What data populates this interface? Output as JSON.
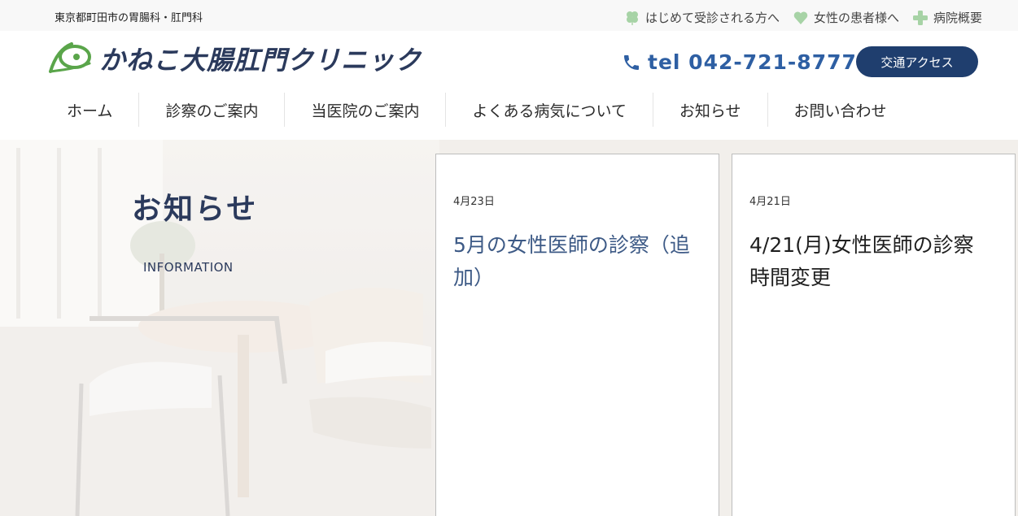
{
  "topbar": {
    "region": "東京都町田市の胃腸科・肛門科",
    "links": [
      {
        "label": "はじめて受診される方へ",
        "icon": "clover-icon",
        "color": "#a7d3a6"
      },
      {
        "label": "女性の患者様へ",
        "icon": "heart-icon",
        "color": "#a7d3a6"
      },
      {
        "label": "病院概要",
        "icon": "cross-icon",
        "color": "#a7d3a6"
      }
    ]
  },
  "header": {
    "logo_text": "かねこ大腸肛門クリニック",
    "phone": "tel 042-721-8777",
    "access_button": "交通アクセス",
    "brand_color": "#1f3e6e",
    "phone_color": "#2e5fa3"
  },
  "nav": {
    "items": [
      "ホーム",
      "診察のご案内",
      "当医院のご案内",
      "よくある病気について",
      "お知らせ",
      "お問い合わせ"
    ]
  },
  "hero": {
    "title": "お知らせ",
    "subtitle": "INFORMATION"
  },
  "news": [
    {
      "date": "4月23日",
      "title": "5月の女性医師の診察（追加）"
    },
    {
      "date": "4月21日",
      "title": "4/21(月)女性医師の診察時間変更"
    }
  ]
}
